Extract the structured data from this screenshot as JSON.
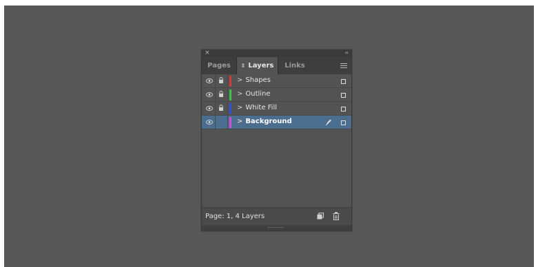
{
  "panel": {
    "close_label": "×",
    "collapse_label": "‹‹",
    "tabs": [
      {
        "label": "Pages",
        "active": false
      },
      {
        "label": "Layers",
        "active": true,
        "arrows": "⇕"
      },
      {
        "label": "Links",
        "active": false
      }
    ],
    "layers": [
      {
        "name": "Shapes",
        "color": "#d23b3b",
        "visible": true,
        "locked": true,
        "selected": false
      },
      {
        "name": "Outline",
        "color": "#3fc44a",
        "visible": true,
        "locked": true,
        "selected": false
      },
      {
        "name": "White Fill",
        "color": "#2e4fd6",
        "visible": true,
        "locked": true,
        "selected": false
      },
      {
        "name": "Background",
        "color": "#d04fd4",
        "visible": true,
        "locked": false,
        "selected": true
      }
    ],
    "chevron": ">",
    "status": "Page: 1, 4 Layers"
  },
  "colors": {
    "canvas": "#575757",
    "panel": "#535353",
    "selection": "#4c6e8e"
  },
  "icons": [
    "close-icon",
    "collapse-icon",
    "panel-menu-icon",
    "visibility-eye-icon",
    "lock-icon",
    "pen-icon",
    "new-layer-icon",
    "trash-icon"
  ]
}
